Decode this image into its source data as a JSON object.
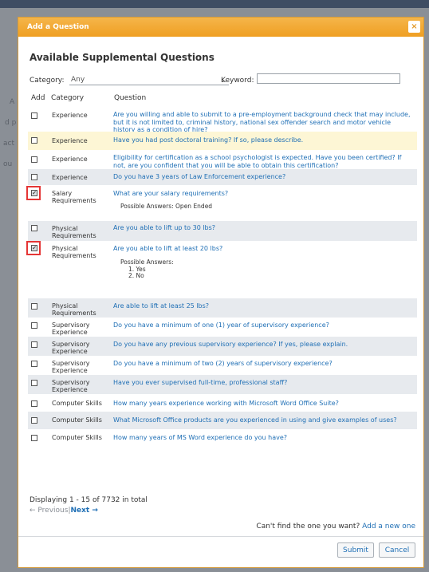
{
  "background": {
    "side_letters": [
      "A",
      "d p",
      "act",
      "ou"
    ]
  },
  "dialog": {
    "title": "Add a Question",
    "close_glyph": "×",
    "heading": "Available Supplemental Questions",
    "filters": {
      "category_label": "Category:",
      "category_value": "Any",
      "keyword_label": "Keyword:",
      "keyword_value": ""
    },
    "columns": {
      "add": "Add",
      "category": "Category",
      "question": "Question"
    },
    "rows": [
      {
        "category": "Experience",
        "question": "Are you willing and able to submit to a pre-employment background check that may include, but it is not limited to, criminal history, national sex offender search and motor vehicle history as a condition of hire?",
        "checked": false
      },
      {
        "category": "Experience",
        "question": "Have you had post doctoral training? If so, please describe.",
        "checked": false
      },
      {
        "category": "Experience",
        "question": "Eligibility for certification as a school psychologist is expected. Have you been certified? If not, are you confident that you will be able to obtain this certification?",
        "checked": false
      },
      {
        "category": "Experience",
        "question": "Do you have 3 years of Law Enforcement experience?",
        "checked": false
      },
      {
        "category": "Salary Requirements",
        "question": "What are your salary requirements?",
        "checked": true,
        "answers_text": "Possible Answers: Open Ended"
      },
      {
        "category": "Physical Requirements",
        "question": "Are you able to lift up to 30 lbs?",
        "checked": false
      },
      {
        "category": "Physical Requirements",
        "question": "Are you able to lift at least 20 lbs?",
        "checked": true,
        "answers_label": "Possible Answers:",
        "answers": [
          "1. Yes",
          "2. No"
        ]
      },
      {
        "category": "Physical Requirements",
        "question": "Are able to lift at least 25 lbs?",
        "checked": false
      },
      {
        "category": "Supervisory Experience",
        "question": "Do you have a minimum of one (1) year of supervisory experience?",
        "checked": false
      },
      {
        "category": "Supervisory Experience",
        "question": "Do you have any previous supervisory experience? If yes, please explain.",
        "checked": false
      },
      {
        "category": "Supervisory Experience",
        "question": "Do you have a minimum of two (2) years of supervisory experience?",
        "checked": false
      },
      {
        "category": "Supervisory Experience",
        "question": "Have you ever supervised full-time, professional staff?",
        "checked": false
      },
      {
        "category": "Computer Skills",
        "question": "How many years experience working with Microsoft Word Office Suite?",
        "checked": false
      },
      {
        "category": "Computer Skills",
        "question": "What Microsoft Office products are you experienced in using and give examples of uses?",
        "checked": false
      },
      {
        "category": "Computer Skills",
        "question": "How many years of MS Word experience do you have?",
        "checked": false
      }
    ],
    "displaying": "Displaying 1 - 15 of 7732 in total",
    "pager": {
      "previous": "← Previous",
      "separator": "|",
      "next": "Next →"
    },
    "cant_find_text": "Can't find the one you want?",
    "add_new_link": "Add a new one",
    "submit_label": "Submit",
    "cancel_label": "Cancel"
  }
}
